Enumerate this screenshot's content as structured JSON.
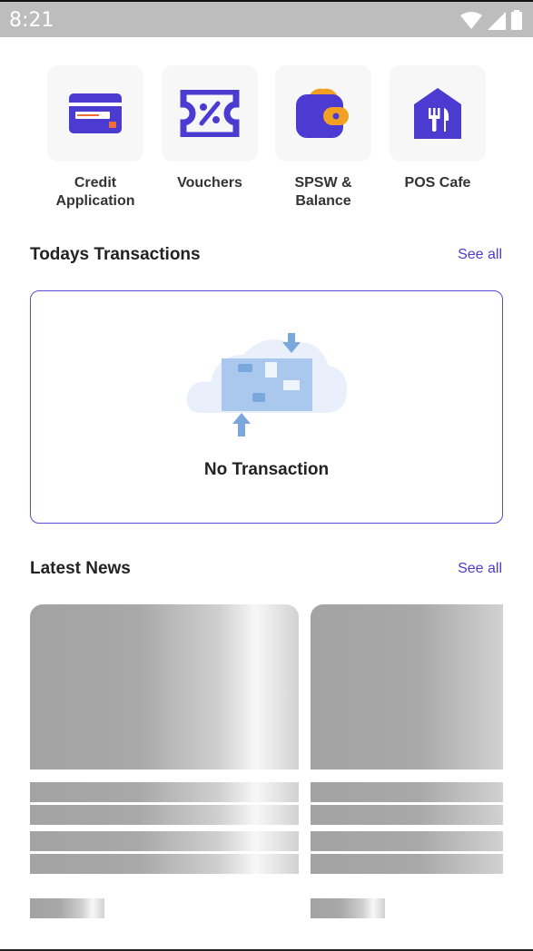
{
  "status_bar": {
    "time": "8:21"
  },
  "menu": [
    {
      "label": "Credit\nApplication",
      "icon": "credit-card-icon"
    },
    {
      "label": "Vouchers",
      "icon": "voucher-icon"
    },
    {
      "label": "SPSW &\nBalance",
      "icon": "wallet-icon"
    },
    {
      "label": "POS Cafe",
      "icon": "cafe-icon"
    }
  ],
  "transactions": {
    "title": "Todays Transactions",
    "see_all": "See all",
    "empty_text": "No Transaction"
  },
  "news": {
    "title": "Latest News",
    "see_all": "See all"
  },
  "colors": {
    "accent": "#4b3bd1",
    "icon_orange": "#f2a024"
  }
}
